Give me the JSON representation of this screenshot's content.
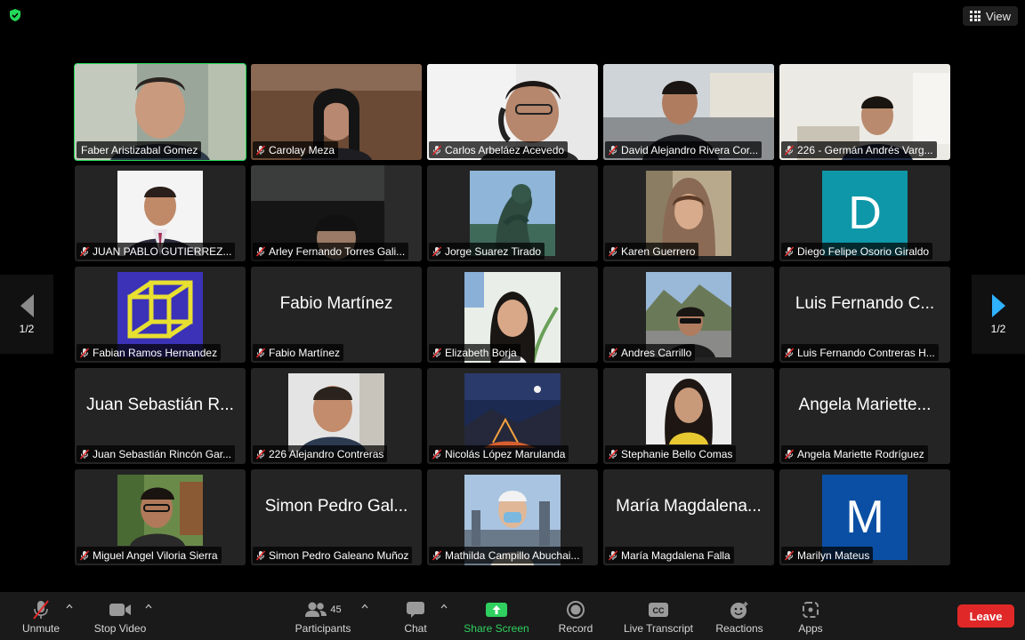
{
  "top": {
    "view_label": "View"
  },
  "pager": {
    "left_label": "1/2",
    "right_label": "1/2"
  },
  "participants": [
    {
      "name": "Faber Aristizabal Gomez",
      "muted": false,
      "type": "video",
      "scene": "faber"
    },
    {
      "name": "Carolay Meza",
      "muted": true,
      "type": "video",
      "scene": "carolay"
    },
    {
      "name": "Carlos Arbeláez Acevedo",
      "muted": true,
      "type": "video",
      "scene": "carlos"
    },
    {
      "name": "David Alejandro Rivera Cor...",
      "muted": true,
      "type": "video",
      "scene": "david"
    },
    {
      "name": "226 - Germán Andrés Varg...",
      "muted": true,
      "type": "video",
      "scene": "german"
    },
    {
      "name": "JUAN PABLO GUTIERREZ...",
      "muted": true,
      "type": "photo",
      "scene": "juanpablo"
    },
    {
      "name": "Arley Fernando Torres Gali...",
      "muted": true,
      "type": "video",
      "scene": "arley"
    },
    {
      "name": "Jorge Suarez Tirado",
      "muted": true,
      "type": "photo",
      "scene": "jorge"
    },
    {
      "name": "Karen Guerrero",
      "muted": true,
      "type": "photo",
      "scene": "karen"
    },
    {
      "name": "Diego Felipe Osorio Giraldo",
      "muted": true,
      "type": "letter",
      "letter": "D",
      "color": "#0e97a8"
    },
    {
      "name": "Fabian Ramos Hernandez",
      "muted": true,
      "type": "photo",
      "scene": "fabian"
    },
    {
      "name": "Fabio Martínez",
      "muted": true,
      "type": "name",
      "display": "Fabio Martínez"
    },
    {
      "name": "Elizabeth Borja",
      "muted": true,
      "type": "photo",
      "scene": "elizabeth"
    },
    {
      "name": "Andres Carrillo",
      "muted": true,
      "type": "photo",
      "scene": "andres"
    },
    {
      "name": "Luis Fernando Contreras H...",
      "muted": true,
      "type": "name",
      "display": "Luis Fernando C..."
    },
    {
      "name": "Juan Sebastián Rincón Gar...",
      "muted": true,
      "type": "name",
      "display": "Juan Sebastián R..."
    },
    {
      "name": "226 Alejandro Contreras",
      "muted": true,
      "type": "photo",
      "scene": "alejandro"
    },
    {
      "name": "Nicolás López Marulanda",
      "muted": true,
      "type": "photo",
      "scene": "nicolas"
    },
    {
      "name": "Stephanie Bello Comas",
      "muted": true,
      "type": "photo",
      "scene": "stephanie"
    },
    {
      "name": "Angela Mariette Rodríguez",
      "muted": true,
      "type": "name",
      "display": "Angela Mariette..."
    },
    {
      "name": "Miguel Angel Viloria Sierra",
      "muted": true,
      "type": "photo",
      "scene": "miguel"
    },
    {
      "name": "Simon Pedro Galeano Muñoz",
      "muted": true,
      "type": "name",
      "display": "Simon Pedro Gal..."
    },
    {
      "name": "Mathilda Campillo Abuchai...",
      "muted": true,
      "type": "photo",
      "scene": "mathilda"
    },
    {
      "name": "María Magdalena Falla",
      "muted": true,
      "type": "name",
      "display": "María Magdalena..."
    },
    {
      "name": "Marilyn Mateus",
      "muted": true,
      "type": "letter",
      "letter": "M",
      "color": "#0a4fa3"
    }
  ],
  "toolbar": {
    "unmute": "Unmute",
    "stop_video": "Stop Video",
    "participants": "Participants",
    "participants_count": "45",
    "chat": "Chat",
    "share_screen": "Share Screen",
    "record": "Record",
    "live_transcript": "Live Transcript",
    "live_transcript_badge": "CC",
    "reactions": "Reactions",
    "apps": "Apps",
    "leave": "Leave"
  },
  "colors": {
    "active_speaker": "#23d959",
    "share_green": "#2fd05f",
    "leave_red": "#e02828",
    "page_arrow_blue": "#2fb2ff"
  }
}
